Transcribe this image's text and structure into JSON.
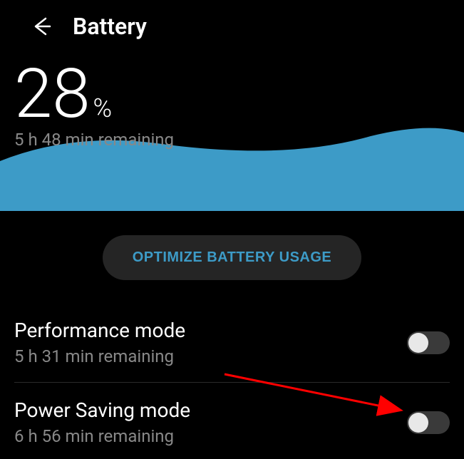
{
  "header": {
    "title": "Battery"
  },
  "battery": {
    "percent": "28",
    "percent_symbol": "%",
    "remaining": "5 h 48 min remaining"
  },
  "optimize_button": "OPTIMIZE BATTERY USAGE",
  "modes": [
    {
      "title": "Performance mode",
      "subtitle": "5 h 31 min remaining",
      "enabled": false
    },
    {
      "title": "Power Saving mode",
      "subtitle": "6 h 56 min remaining",
      "enabled": false
    }
  ],
  "colors": {
    "wave": "#3d9bc7",
    "accent": "#3d9bc7"
  }
}
